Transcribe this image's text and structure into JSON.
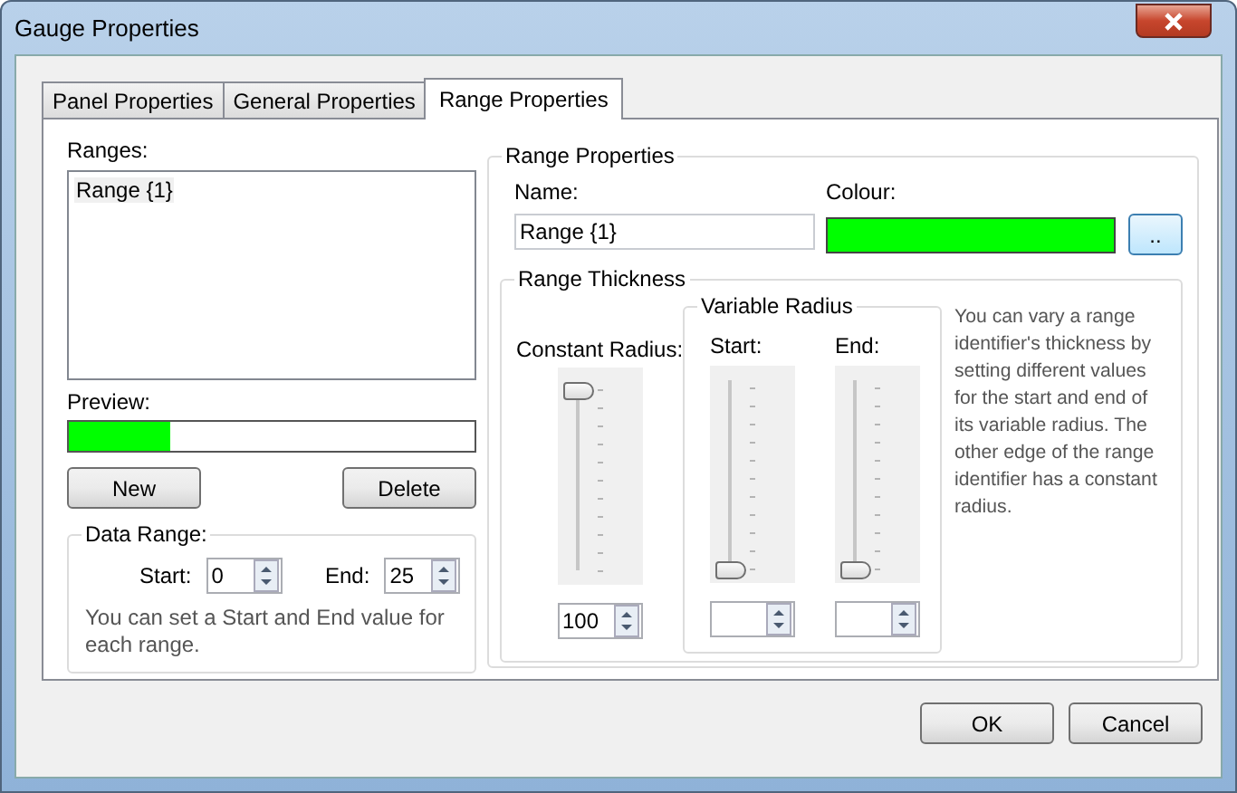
{
  "window": {
    "title": "Gauge Properties"
  },
  "tabs": [
    {
      "label": "Panel Properties",
      "selected": false
    },
    {
      "label": "General Properties",
      "selected": false
    },
    {
      "label": "Range Properties",
      "selected": true
    }
  ],
  "ranges": {
    "label": "Ranges:",
    "items": [
      {
        "label": "Range {1}",
        "selected": true
      }
    ]
  },
  "preview": {
    "label": "Preview:",
    "level": 0.25
  },
  "range_buttons": [
    "New",
    "Delete"
  ],
  "data_range": {
    "title": "Data Range:",
    "start": {
      "label": "Start:",
      "value": "0"
    },
    "end": {
      "label": "End:",
      "value": "25"
    },
    "note": "You can set a Start and End value for each range."
  },
  "range_properties": {
    "title": "Range Properties",
    "name": {
      "label": "Name:",
      "value": "Range {1}"
    },
    "colour": {
      "label": "Colour:",
      "color": "#00ff00"
    },
    "browse_button": ".."
  },
  "range_thickness": {
    "title": "Range Thickness",
    "constant": {
      "label": "Constant Radius:",
      "level": 1,
      "value": "100"
    },
    "variable": {
      "title": "Variable Radius",
      "start": {
        "label": "Start:",
        "level": 0
      },
      "end": {
        "label": "End:",
        "level": 0
      }
    },
    "note": "You can vary a range identifier's thickness by setting different values for the start and end of its variable radius. The other edge of the range identifier has a constant radius."
  },
  "dialog_buttons": [
    "OK",
    "Cancel"
  ]
}
